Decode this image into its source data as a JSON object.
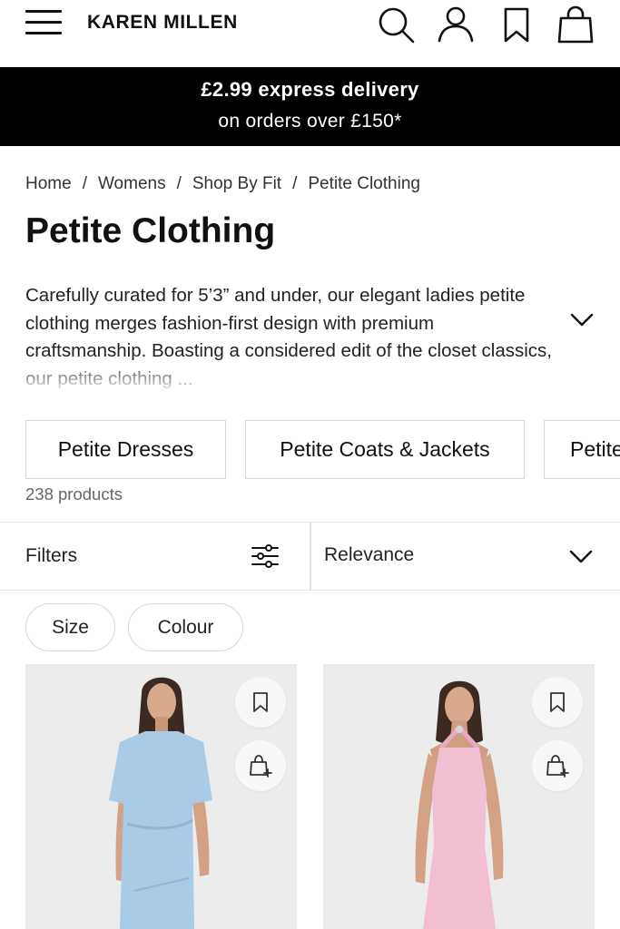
{
  "header": {
    "brand": "KAREN MILLEN",
    "icons": [
      "menu-icon",
      "search-icon",
      "account-icon",
      "wishlist-icon",
      "bag-icon"
    ]
  },
  "promo": {
    "line1": "£2.99 express delivery",
    "line2": "on orders over £150*"
  },
  "breadcrumb": {
    "items": [
      "Home",
      "Womens",
      "Shop By Fit",
      "Petite Clothing"
    ],
    "separator": "/"
  },
  "page": {
    "title": "Petite Clothing",
    "description": "Carefully curated for 5’3” and under, our elegant ladies petite clothing merges fashion-first design with premium craftsmanship. Boasting a considered edit of the closet classics, our petite clothing ...",
    "product_count": "238 products"
  },
  "categories": [
    "Petite Dresses",
    "Petite Coats & Jackets",
    "Petite"
  ],
  "filter_bar": {
    "filters_label": "Filters",
    "sort_value": "Relevance"
  },
  "filter_pills": [
    "Size",
    "Colour"
  ],
  "products": [
    {
      "name": "",
      "dress_color": "#a9cbe6"
    },
    {
      "name": "",
      "dress_color": "#f2bfd2"
    }
  ],
  "colors": {
    "brand_black": "#000000",
    "border": "#d6d6d6"
  }
}
